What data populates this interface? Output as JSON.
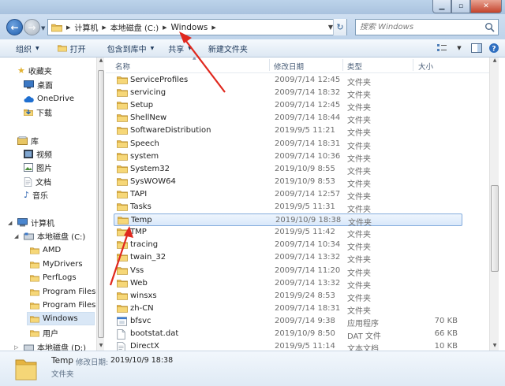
{
  "address_bar": {
    "crumbs": [
      "计算机",
      "本地磁盘 (C:)",
      "Windows"
    ]
  },
  "search": {
    "placeholder": "搜索 Windows"
  },
  "toolbar": {
    "organize": "组织",
    "open": "打开",
    "include_in_library": "包含到库中",
    "share": "共享",
    "new_folder": "新建文件夹"
  },
  "columns": {
    "name": "名称",
    "date": "修改日期",
    "type": "类型",
    "size": "大小"
  },
  "nav": {
    "favorites": "收藏夹",
    "desktop": "桌面",
    "onedrive": "OneDrive",
    "downloads": "下载",
    "libraries": "库",
    "videos": "视频",
    "pictures": "图片",
    "documents": "文档",
    "music": "音乐",
    "computer": "计算机",
    "local_disk_c": "本地磁盘 (C:)",
    "amd": "AMD",
    "mydrivers": "MyDrivers",
    "perflogs": "PerfLogs",
    "program_files": "Program Files",
    "program_files_x86": "Program Files (",
    "windows": "Windows",
    "users": "用户",
    "local_disk_d": "本地磁盘 (D:)"
  },
  "files": [
    {
      "name": "ServiceProfiles",
      "date": "2009/7/14 12:45",
      "type": "文件夹",
      "size": "",
      "icon": "folder-icon"
    },
    {
      "name": "servicing",
      "date": "2009/7/14 18:32",
      "type": "文件夹",
      "size": "",
      "icon": "folder-icon"
    },
    {
      "name": "Setup",
      "date": "2009/7/14 12:45",
      "type": "文件夹",
      "size": "",
      "icon": "folder-icon"
    },
    {
      "name": "ShellNew",
      "date": "2009/7/14 18:44",
      "type": "文件夹",
      "size": "",
      "icon": "folder-icon"
    },
    {
      "name": "SoftwareDistribution",
      "date": "2019/9/5 11:21",
      "type": "文件夹",
      "size": "",
      "icon": "folder-icon"
    },
    {
      "name": "Speech",
      "date": "2009/7/14 18:31",
      "type": "文件夹",
      "size": "",
      "icon": "folder-icon"
    },
    {
      "name": "system",
      "date": "2009/7/14 10:36",
      "type": "文件夹",
      "size": "",
      "icon": "folder-icon"
    },
    {
      "name": "System32",
      "date": "2019/10/9 8:55",
      "type": "文件夹",
      "size": "",
      "icon": "folder-icon"
    },
    {
      "name": "SysWOW64",
      "date": "2019/10/9 8:53",
      "type": "文件夹",
      "size": "",
      "icon": "folder-icon"
    },
    {
      "name": "TAPI",
      "date": "2009/7/14 12:57",
      "type": "文件夹",
      "size": "",
      "icon": "folder-icon"
    },
    {
      "name": "Tasks",
      "date": "2019/9/5 11:31",
      "type": "文件夹",
      "size": "",
      "icon": "folder-icon"
    },
    {
      "name": "Temp",
      "date": "2019/10/9 18:38",
      "type": "文件夹",
      "size": "",
      "icon": "folder-icon",
      "selected": true
    },
    {
      "name": "TMP",
      "date": "2019/9/5 11:42",
      "type": "文件夹",
      "size": "",
      "icon": "folder-icon"
    },
    {
      "name": "tracing",
      "date": "2009/7/14 10:34",
      "type": "文件夹",
      "size": "",
      "icon": "folder-icon"
    },
    {
      "name": "twain_32",
      "date": "2009/7/14 13:32",
      "type": "文件夹",
      "size": "",
      "icon": "folder-icon"
    },
    {
      "name": "Vss",
      "date": "2009/7/14 11:20",
      "type": "文件夹",
      "size": "",
      "icon": "folder-icon"
    },
    {
      "name": "Web",
      "date": "2009/7/14 13:32",
      "type": "文件夹",
      "size": "",
      "icon": "folder-icon"
    },
    {
      "name": "winsxs",
      "date": "2019/9/24 8:53",
      "type": "文件夹",
      "size": "",
      "icon": "folder-icon"
    },
    {
      "name": "zh-CN",
      "date": "2009/7/14 18:31",
      "type": "文件夹",
      "size": "",
      "icon": "folder-icon"
    },
    {
      "name": "bfsvc",
      "date": "2009/7/14 9:38",
      "type": "应用程序",
      "size": "70 KB",
      "icon": "exe-icon"
    },
    {
      "name": "bootstat.dat",
      "date": "2019/10/9 8:50",
      "type": "DAT 文件",
      "size": "66 KB",
      "icon": "file-icon"
    },
    {
      "name": "DirectX",
      "date": "2019/9/5 11:14",
      "type": "文本文档",
      "size": "10 KB",
      "icon": "text-file-icon"
    }
  ],
  "details": {
    "name": "Temp",
    "modified_label": "修改日期:",
    "modified_value": "2019/10/9 18:38",
    "kind": "文件夹"
  },
  "colors": {
    "selection_border": "#84acdd",
    "selection_fill": "#d9e8fa",
    "annotation_arrow": "#e0281e",
    "folder": "#f1c85a"
  }
}
